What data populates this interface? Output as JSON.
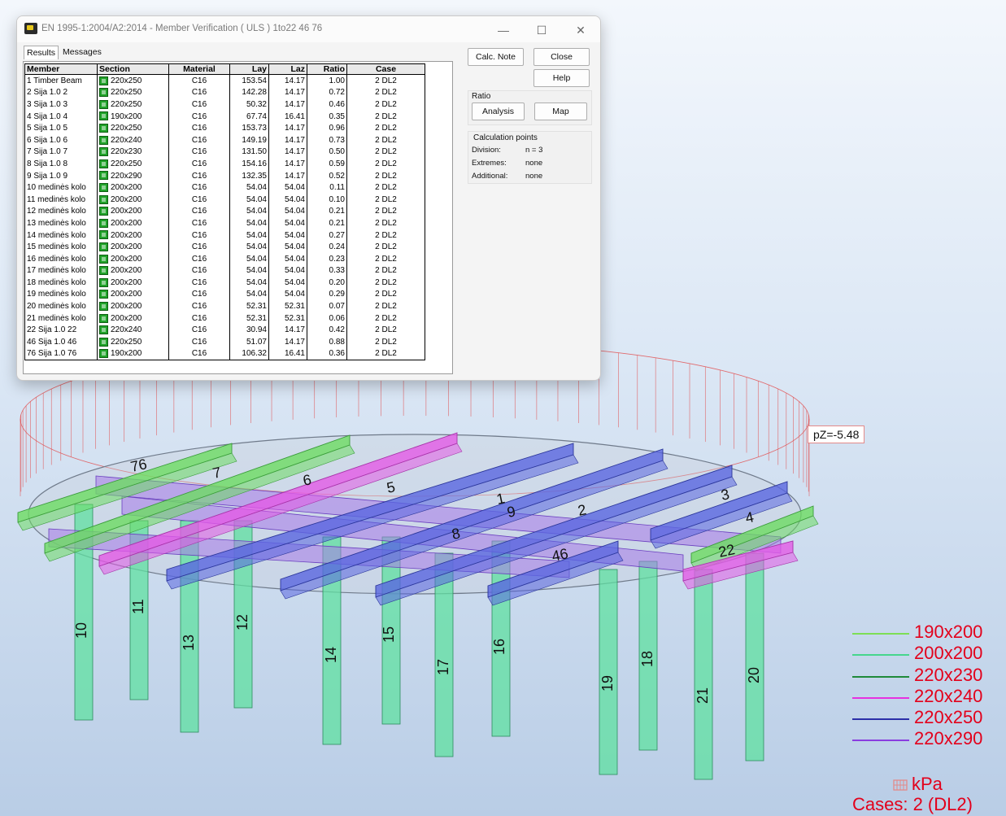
{
  "window": {
    "title": "EN 1995-1:2004/A2:2014 - Member Verification ( ULS ) 1to22 46 76",
    "min_glyph": "—",
    "max_glyph": "☐",
    "close_glyph": "✕",
    "tabs": [
      "Results",
      "Messages"
    ],
    "table": {
      "headers": [
        "Member",
        "Section",
        "Material",
        "Lay",
        "Laz",
        "Ratio",
        "Case"
      ],
      "rows": [
        {
          "member": "1  Timber Beam",
          "section": "220x250",
          "material": "C16",
          "lay": "153.54",
          "laz": "14.17",
          "ratio": "1.00",
          "case": "2 DL2"
        },
        {
          "member": "2  Sija 1.0  2",
          "section": "220x250",
          "material": "C16",
          "lay": "142.28",
          "laz": "14.17",
          "ratio": "0.72",
          "case": "2 DL2"
        },
        {
          "member": "3  Sija 1.0  3",
          "section": "220x250",
          "material": "C16",
          "lay": "50.32",
          "laz": "14.17",
          "ratio": "0.46",
          "case": "2 DL2"
        },
        {
          "member": "4  Sija 1.0  4",
          "section": "190x200",
          "material": "C16",
          "lay": "67.74",
          "laz": "16.41",
          "ratio": "0.35",
          "case": "2 DL2"
        },
        {
          "member": "5  Sija 1.0  5",
          "section": "220x250",
          "material": "C16",
          "lay": "153.73",
          "laz": "14.17",
          "ratio": "0.96",
          "case": "2 DL2"
        },
        {
          "member": "6  Sija 1.0  6",
          "section": "220x240",
          "material": "C16",
          "lay": "149.19",
          "laz": "14.17",
          "ratio": "0.73",
          "case": "2 DL2"
        },
        {
          "member": "7  Sija 1.0  7",
          "section": "220x230",
          "material": "C16",
          "lay": "131.50",
          "laz": "14.17",
          "ratio": "0.50",
          "case": "2 DL2"
        },
        {
          "member": "8  Sija 1.0  8",
          "section": "220x250",
          "material": "C16",
          "lay": "154.16",
          "laz": "14.17",
          "ratio": "0.59",
          "case": "2 DL2"
        },
        {
          "member": "9  Sija 1.0  9",
          "section": "220x290",
          "material": "C16",
          "lay": "132.35",
          "laz": "14.17",
          "ratio": "0.52",
          "case": "2 DL2"
        },
        {
          "member": "10  medinės kolo",
          "section": "200x200",
          "material": "C16",
          "lay": "54.04",
          "laz": "54.04",
          "ratio": "0.11",
          "case": "2 DL2"
        },
        {
          "member": "11  medinės kolo",
          "section": "200x200",
          "material": "C16",
          "lay": "54.04",
          "laz": "54.04",
          "ratio": "0.10",
          "case": "2 DL2"
        },
        {
          "member": "12  medinės kolo",
          "section": "200x200",
          "material": "C16",
          "lay": "54.04",
          "laz": "54.04",
          "ratio": "0.21",
          "case": "2 DL2"
        },
        {
          "member": "13  medinės kolo",
          "section": "200x200",
          "material": "C16",
          "lay": "54.04",
          "laz": "54.04",
          "ratio": "0.21",
          "case": "2 DL2"
        },
        {
          "member": "14  medinės kolo",
          "section": "200x200",
          "material": "C16",
          "lay": "54.04",
          "laz": "54.04",
          "ratio": "0.27",
          "case": "2 DL2"
        },
        {
          "member": "15  medinės kolo",
          "section": "200x200",
          "material": "C16",
          "lay": "54.04",
          "laz": "54.04",
          "ratio": "0.24",
          "case": "2 DL2"
        },
        {
          "member": "16  medinės kolo",
          "section": "200x200",
          "material": "C16",
          "lay": "54.04",
          "laz": "54.04",
          "ratio": "0.23",
          "case": "2 DL2"
        },
        {
          "member": "17  medinės kolo",
          "section": "200x200",
          "material": "C16",
          "lay": "54.04",
          "laz": "54.04",
          "ratio": "0.33",
          "case": "2 DL2"
        },
        {
          "member": "18  medinės kolo",
          "section": "200x200",
          "material": "C16",
          "lay": "54.04",
          "laz": "54.04",
          "ratio": "0.20",
          "case": "2 DL2"
        },
        {
          "member": "19  medinės kolo",
          "section": "200x200",
          "material": "C16",
          "lay": "54.04",
          "laz": "54.04",
          "ratio": "0.29",
          "case": "2 DL2"
        },
        {
          "member": "20  medinės kolo",
          "section": "200x200",
          "material": "C16",
          "lay": "52.31",
          "laz": "52.31",
          "ratio": "0.07",
          "case": "2 DL2"
        },
        {
          "member": "21  medinės kolo",
          "section": "200x200",
          "material": "C16",
          "lay": "52.31",
          "laz": "52.31",
          "ratio": "0.06",
          "case": "2 DL2"
        },
        {
          "member": "22  Sija 1.0  22",
          "section": "220x240",
          "material": "C16",
          "lay": "30.94",
          "laz": "14.17",
          "ratio": "0.42",
          "case": "2 DL2"
        },
        {
          "member": "46  Sija 1.0  46",
          "section": "220x250",
          "material": "C16",
          "lay": "51.07",
          "laz": "14.17",
          "ratio": "0.88",
          "case": "2 DL2"
        },
        {
          "member": "76  Sija 1.0  76",
          "section": "190x200",
          "material": "C16",
          "lay": "106.32",
          "laz": "16.41",
          "ratio": "0.36",
          "case": "2 DL2"
        }
      ]
    },
    "buttons": {
      "calc_note": "Calc. Note",
      "close": "Close",
      "help": "Help",
      "analysis": "Analysis",
      "map": "Map"
    },
    "ratio_group": "Ratio",
    "calc_points": {
      "title": "Calculation points",
      "division_label": "Division:",
      "division_value": "n = 3",
      "extremes_label": "Extremes:",
      "extremes_value": "none",
      "additional_label": "Additional:",
      "additional_value": "none"
    }
  },
  "viewport": {
    "load_label": "pZ=-5.48",
    "beam_labels": [
      "76",
      "7",
      "6",
      "5",
      "1",
      "9",
      "2",
      "3",
      "4",
      "8",
      "46",
      "22"
    ],
    "column_labels": [
      "10",
      "11",
      "13",
      "12",
      "14",
      "15",
      "17",
      "16",
      "19",
      "18",
      "21",
      "20"
    ],
    "legend": [
      {
        "label": "190x200",
        "color": "#7ddf55"
      },
      {
        "label": "200x200",
        "color": "#46d68c"
      },
      {
        "label": "220x230",
        "color": "#1f8a3a"
      },
      {
        "label": "220x240",
        "color": "#e632e0"
      },
      {
        "label": "220x250",
        "color": "#2c2fa8"
      },
      {
        "label": "220x290",
        "color": "#8a3de0"
      }
    ],
    "unit": "kPa",
    "cases": "Cases: 2 (DL2)"
  },
  "colors": {
    "beam_blue": "#5a66e0",
    "beam_magenta": "#e45ae6",
    "beam_green": "#6ddc62",
    "column_green": "#5fe0a0",
    "load_red": "#e24a4a"
  }
}
